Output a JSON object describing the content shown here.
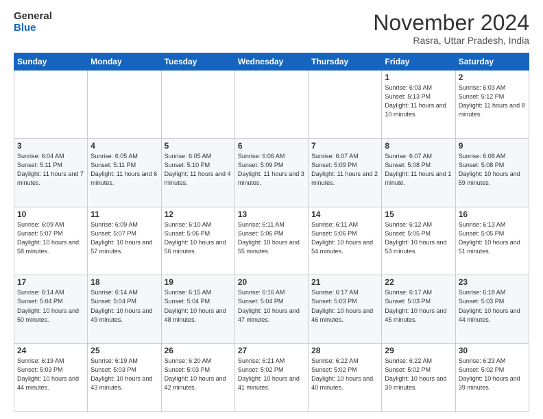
{
  "header": {
    "logo_general": "General",
    "logo_blue": "Blue",
    "month_title": "November 2024",
    "location": "Rasra, Uttar Pradesh, India"
  },
  "weekdays": [
    "Sunday",
    "Monday",
    "Tuesday",
    "Wednesday",
    "Thursday",
    "Friday",
    "Saturday"
  ],
  "weeks": [
    [
      {
        "day": "",
        "info": ""
      },
      {
        "day": "",
        "info": ""
      },
      {
        "day": "",
        "info": ""
      },
      {
        "day": "",
        "info": ""
      },
      {
        "day": "",
        "info": ""
      },
      {
        "day": "1",
        "info": "Sunrise: 6:03 AM\nSunset: 5:13 PM\nDaylight: 11 hours\nand 10 minutes."
      },
      {
        "day": "2",
        "info": "Sunrise: 6:03 AM\nSunset: 5:12 PM\nDaylight: 11 hours\nand 8 minutes."
      }
    ],
    [
      {
        "day": "3",
        "info": "Sunrise: 6:04 AM\nSunset: 5:11 PM\nDaylight: 11 hours\nand 7 minutes."
      },
      {
        "day": "4",
        "info": "Sunrise: 6:05 AM\nSunset: 5:11 PM\nDaylight: 11 hours\nand 6 minutes."
      },
      {
        "day": "5",
        "info": "Sunrise: 6:05 AM\nSunset: 5:10 PM\nDaylight: 11 hours\nand 4 minutes."
      },
      {
        "day": "6",
        "info": "Sunrise: 6:06 AM\nSunset: 5:09 PM\nDaylight: 11 hours\nand 3 minutes."
      },
      {
        "day": "7",
        "info": "Sunrise: 6:07 AM\nSunset: 5:09 PM\nDaylight: 11 hours\nand 2 minutes."
      },
      {
        "day": "8",
        "info": "Sunrise: 6:07 AM\nSunset: 5:08 PM\nDaylight: 11 hours\nand 1 minute."
      },
      {
        "day": "9",
        "info": "Sunrise: 6:08 AM\nSunset: 5:08 PM\nDaylight: 10 hours\nand 59 minutes."
      }
    ],
    [
      {
        "day": "10",
        "info": "Sunrise: 6:09 AM\nSunset: 5:07 PM\nDaylight: 10 hours\nand 58 minutes."
      },
      {
        "day": "11",
        "info": "Sunrise: 6:09 AM\nSunset: 5:07 PM\nDaylight: 10 hours\nand 57 minutes."
      },
      {
        "day": "12",
        "info": "Sunrise: 6:10 AM\nSunset: 5:06 PM\nDaylight: 10 hours\nand 56 minutes."
      },
      {
        "day": "13",
        "info": "Sunrise: 6:11 AM\nSunset: 5:06 PM\nDaylight: 10 hours\nand 55 minutes."
      },
      {
        "day": "14",
        "info": "Sunrise: 6:11 AM\nSunset: 5:06 PM\nDaylight: 10 hours\nand 54 minutes."
      },
      {
        "day": "15",
        "info": "Sunrise: 6:12 AM\nSunset: 5:05 PM\nDaylight: 10 hours\nand 53 minutes."
      },
      {
        "day": "16",
        "info": "Sunrise: 6:13 AM\nSunset: 5:05 PM\nDaylight: 10 hours\nand 51 minutes."
      }
    ],
    [
      {
        "day": "17",
        "info": "Sunrise: 6:14 AM\nSunset: 5:04 PM\nDaylight: 10 hours\nand 50 minutes."
      },
      {
        "day": "18",
        "info": "Sunrise: 6:14 AM\nSunset: 5:04 PM\nDaylight: 10 hours\nand 49 minutes."
      },
      {
        "day": "19",
        "info": "Sunrise: 6:15 AM\nSunset: 5:04 PM\nDaylight: 10 hours\nand 48 minutes."
      },
      {
        "day": "20",
        "info": "Sunrise: 6:16 AM\nSunset: 5:04 PM\nDaylight: 10 hours\nand 47 minutes."
      },
      {
        "day": "21",
        "info": "Sunrise: 6:17 AM\nSunset: 5:03 PM\nDaylight: 10 hours\nand 46 minutes."
      },
      {
        "day": "22",
        "info": "Sunrise: 6:17 AM\nSunset: 5:03 PM\nDaylight: 10 hours\nand 45 minutes."
      },
      {
        "day": "23",
        "info": "Sunrise: 6:18 AM\nSunset: 5:03 PM\nDaylight: 10 hours\nand 44 minutes."
      }
    ],
    [
      {
        "day": "24",
        "info": "Sunrise: 6:19 AM\nSunset: 5:03 PM\nDaylight: 10 hours\nand 44 minutes."
      },
      {
        "day": "25",
        "info": "Sunrise: 6:19 AM\nSunset: 5:03 PM\nDaylight: 10 hours\nand 43 minutes."
      },
      {
        "day": "26",
        "info": "Sunrise: 6:20 AM\nSunset: 5:03 PM\nDaylight: 10 hours\nand 42 minutes."
      },
      {
        "day": "27",
        "info": "Sunrise: 6:21 AM\nSunset: 5:02 PM\nDaylight: 10 hours\nand 41 minutes."
      },
      {
        "day": "28",
        "info": "Sunrise: 6:22 AM\nSunset: 5:02 PM\nDaylight: 10 hours\nand 40 minutes."
      },
      {
        "day": "29",
        "info": "Sunrise: 6:22 AM\nSunset: 5:02 PM\nDaylight: 10 hours\nand 39 minutes."
      },
      {
        "day": "30",
        "info": "Sunrise: 6:23 AM\nSunset: 5:02 PM\nDaylight: 10 hours\nand 39 minutes."
      }
    ]
  ]
}
